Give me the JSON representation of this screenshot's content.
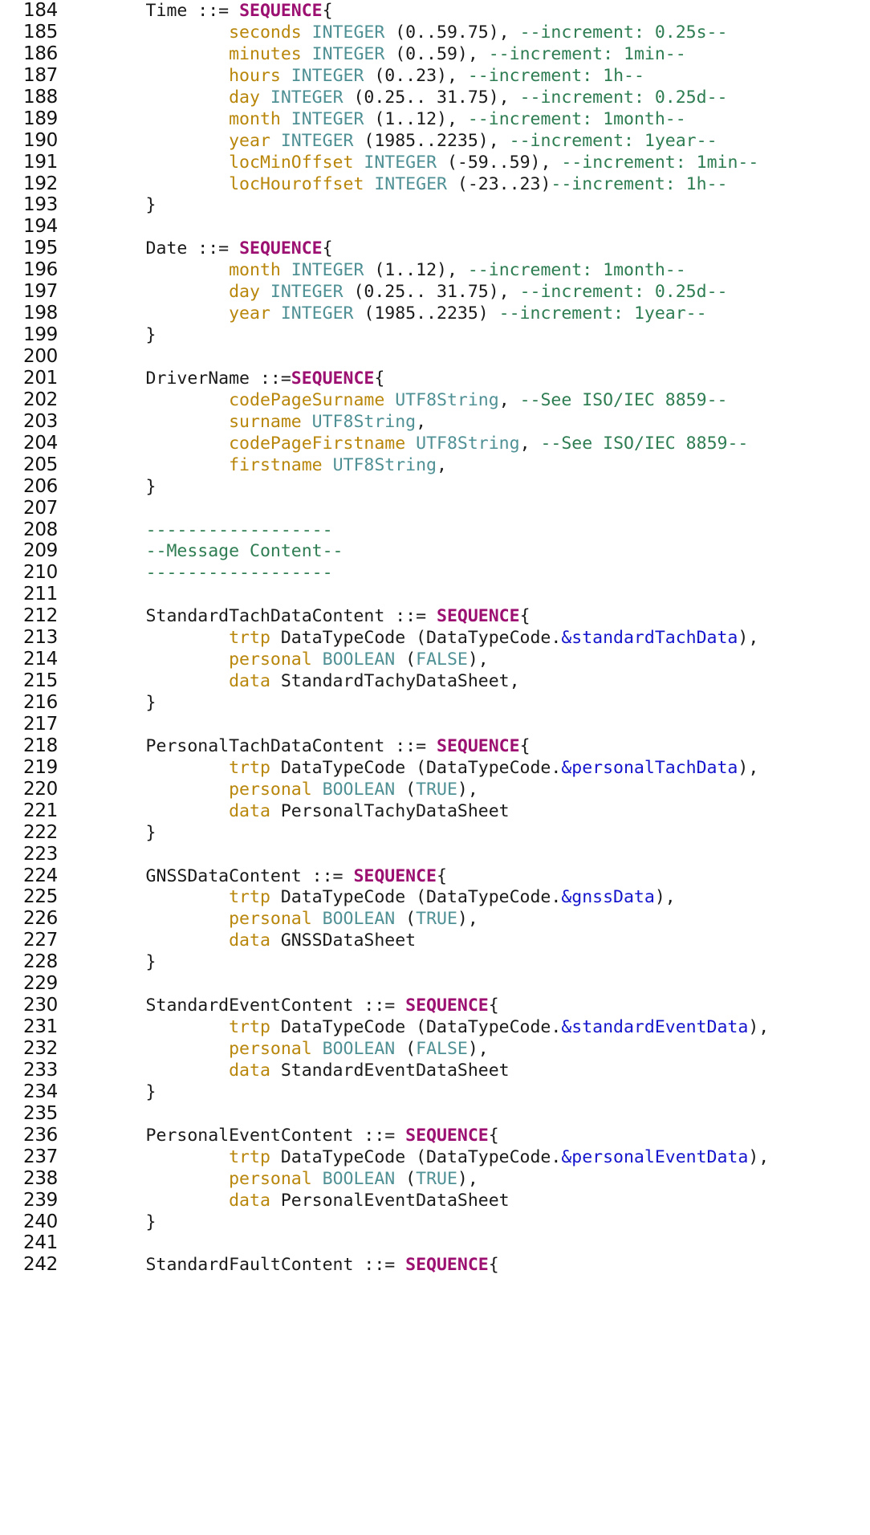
{
  "editor": {
    "language": "ASN.1",
    "first_line_number": 184,
    "last_line_number": 242,
    "colors": {
      "background": "#ffffff",
      "line_number": "#111111",
      "plain": "#1a1a1a",
      "field_name": "#B8860B",
      "type_name": "#4F9095",
      "comment": "#2E7D52",
      "keyword": "#9B1070",
      "reference": "#1414CC"
    }
  },
  "lines": [
    {
      "n": "184",
      "tokens": [
        {
          "t": "        Time ::= ",
          "c": "plain"
        },
        {
          "t": "SEQUENCE",
          "c": "kw"
        },
        {
          "t": "{",
          "c": "plain"
        }
      ]
    },
    {
      "n": "185",
      "tokens": [
        {
          "t": "                ",
          "c": "plain"
        },
        {
          "t": "seconds",
          "c": "field"
        },
        {
          "t": " ",
          "c": "plain"
        },
        {
          "t": "INTEGER",
          "c": "type"
        },
        {
          "t": " (0..59.75), ",
          "c": "plain"
        },
        {
          "t": "--increment: 0.25s--",
          "c": "comment"
        }
      ]
    },
    {
      "n": "186",
      "tokens": [
        {
          "t": "                ",
          "c": "plain"
        },
        {
          "t": "minutes",
          "c": "field"
        },
        {
          "t": " ",
          "c": "plain"
        },
        {
          "t": "INTEGER",
          "c": "type"
        },
        {
          "t": " (0..59), ",
          "c": "plain"
        },
        {
          "t": "--increment: 1min--",
          "c": "comment"
        }
      ]
    },
    {
      "n": "187",
      "tokens": [
        {
          "t": "                ",
          "c": "plain"
        },
        {
          "t": "hours",
          "c": "field"
        },
        {
          "t": " ",
          "c": "plain"
        },
        {
          "t": "INTEGER",
          "c": "type"
        },
        {
          "t": " (0..23), ",
          "c": "plain"
        },
        {
          "t": "--increment: 1h--",
          "c": "comment"
        }
      ]
    },
    {
      "n": "188",
      "tokens": [
        {
          "t": "                ",
          "c": "plain"
        },
        {
          "t": "day",
          "c": "field"
        },
        {
          "t": " ",
          "c": "plain"
        },
        {
          "t": "INTEGER",
          "c": "type"
        },
        {
          "t": " (0.25.. 31.75), ",
          "c": "plain"
        },
        {
          "t": "--increment: 0.25d--",
          "c": "comment"
        }
      ]
    },
    {
      "n": "189",
      "tokens": [
        {
          "t": "                ",
          "c": "plain"
        },
        {
          "t": "month",
          "c": "field"
        },
        {
          "t": " ",
          "c": "plain"
        },
        {
          "t": "INTEGER",
          "c": "type"
        },
        {
          "t": " (1..12), ",
          "c": "plain"
        },
        {
          "t": "--increment: 1month--",
          "c": "comment"
        }
      ]
    },
    {
      "n": "190",
      "tokens": [
        {
          "t": "                ",
          "c": "plain"
        },
        {
          "t": "year",
          "c": "field"
        },
        {
          "t": " ",
          "c": "plain"
        },
        {
          "t": "INTEGER",
          "c": "type"
        },
        {
          "t": " (1985..2235), ",
          "c": "plain"
        },
        {
          "t": "--increment: 1year--",
          "c": "comment"
        }
      ]
    },
    {
      "n": "191",
      "tokens": [
        {
          "t": "                ",
          "c": "plain"
        },
        {
          "t": "locMinOffset",
          "c": "field"
        },
        {
          "t": " ",
          "c": "plain"
        },
        {
          "t": "INTEGER",
          "c": "type"
        },
        {
          "t": " (-59..59), ",
          "c": "plain"
        },
        {
          "t": "--increment: 1min--",
          "c": "comment"
        }
      ]
    },
    {
      "n": "192",
      "tokens": [
        {
          "t": "                ",
          "c": "plain"
        },
        {
          "t": "locHouroffset",
          "c": "field"
        },
        {
          "t": " ",
          "c": "plain"
        },
        {
          "t": "INTEGER",
          "c": "type"
        },
        {
          "t": " (-23..23)",
          "c": "plain"
        },
        {
          "t": "--increment: 1h--",
          "c": "comment"
        }
      ]
    },
    {
      "n": "193",
      "tokens": [
        {
          "t": "        }",
          "c": "plain"
        }
      ]
    },
    {
      "n": "194",
      "tokens": []
    },
    {
      "n": "195",
      "tokens": [
        {
          "t": "        Date ::= ",
          "c": "plain"
        },
        {
          "t": "SEQUENCE",
          "c": "kw"
        },
        {
          "t": "{",
          "c": "plain"
        }
      ]
    },
    {
      "n": "196",
      "tokens": [
        {
          "t": "                ",
          "c": "plain"
        },
        {
          "t": "month",
          "c": "field"
        },
        {
          "t": " ",
          "c": "plain"
        },
        {
          "t": "INTEGER",
          "c": "type"
        },
        {
          "t": " (1..12), ",
          "c": "plain"
        },
        {
          "t": "--increment: 1month--",
          "c": "comment"
        }
      ]
    },
    {
      "n": "197",
      "tokens": [
        {
          "t": "                ",
          "c": "plain"
        },
        {
          "t": "day",
          "c": "field"
        },
        {
          "t": " ",
          "c": "plain"
        },
        {
          "t": "INTEGER",
          "c": "type"
        },
        {
          "t": " (0.25.. 31.75), ",
          "c": "plain"
        },
        {
          "t": "--increment: 0.25d--",
          "c": "comment"
        }
      ]
    },
    {
      "n": "198",
      "tokens": [
        {
          "t": "                ",
          "c": "plain"
        },
        {
          "t": "year",
          "c": "field"
        },
        {
          "t": " ",
          "c": "plain"
        },
        {
          "t": "INTEGER",
          "c": "type"
        },
        {
          "t": " (1985..2235) ",
          "c": "plain"
        },
        {
          "t": "--increment: 1year--",
          "c": "comment"
        }
      ]
    },
    {
      "n": "199",
      "tokens": [
        {
          "t": "        }",
          "c": "plain"
        }
      ]
    },
    {
      "n": "200",
      "tokens": []
    },
    {
      "n": "201",
      "tokens": [
        {
          "t": "        DriverName ::=",
          "c": "plain"
        },
        {
          "t": "SEQUENCE",
          "c": "kw"
        },
        {
          "t": "{",
          "c": "plain"
        }
      ]
    },
    {
      "n": "202",
      "tokens": [
        {
          "t": "                ",
          "c": "plain"
        },
        {
          "t": "codePageSurname",
          "c": "field"
        },
        {
          "t": " ",
          "c": "plain"
        },
        {
          "t": "UTF8String",
          "c": "type"
        },
        {
          "t": ", ",
          "c": "plain"
        },
        {
          "t": "--See ISO/IEC 8859--",
          "c": "comment"
        }
      ]
    },
    {
      "n": "203",
      "tokens": [
        {
          "t": "                ",
          "c": "plain"
        },
        {
          "t": "surname",
          "c": "field"
        },
        {
          "t": " ",
          "c": "plain"
        },
        {
          "t": "UTF8String",
          "c": "type"
        },
        {
          "t": ",",
          "c": "plain"
        }
      ]
    },
    {
      "n": "204",
      "tokens": [
        {
          "t": "                ",
          "c": "plain"
        },
        {
          "t": "codePageFirstname",
          "c": "field"
        },
        {
          "t": " ",
          "c": "plain"
        },
        {
          "t": "UTF8String",
          "c": "type"
        },
        {
          "t": ", ",
          "c": "plain"
        },
        {
          "t": "--See ISO/IEC 8859--",
          "c": "comment"
        }
      ]
    },
    {
      "n": "205",
      "tokens": [
        {
          "t": "                ",
          "c": "plain"
        },
        {
          "t": "firstname",
          "c": "field"
        },
        {
          "t": " ",
          "c": "plain"
        },
        {
          "t": "UTF8String",
          "c": "type"
        },
        {
          "t": ",",
          "c": "plain"
        }
      ]
    },
    {
      "n": "206",
      "tokens": [
        {
          "t": "        }",
          "c": "plain"
        }
      ]
    },
    {
      "n": "207",
      "tokens": []
    },
    {
      "n": "208",
      "tokens": [
        {
          "t": "        ",
          "c": "plain"
        },
        {
          "t": "------------------",
          "c": "comment"
        }
      ]
    },
    {
      "n": "209",
      "tokens": [
        {
          "t": "        ",
          "c": "plain"
        },
        {
          "t": "--Message Content--",
          "c": "comment"
        }
      ]
    },
    {
      "n": "210",
      "tokens": [
        {
          "t": "        ",
          "c": "plain"
        },
        {
          "t": "------------------",
          "c": "comment"
        }
      ]
    },
    {
      "n": "211",
      "tokens": []
    },
    {
      "n": "212",
      "tokens": [
        {
          "t": "        StandardTachDataContent ::= ",
          "c": "plain"
        },
        {
          "t": "SEQUENCE",
          "c": "kw"
        },
        {
          "t": "{",
          "c": "plain"
        }
      ]
    },
    {
      "n": "213",
      "tokens": [
        {
          "t": "                ",
          "c": "plain"
        },
        {
          "t": "trtp",
          "c": "field"
        },
        {
          "t": " DataTypeCode (DataTypeCode.",
          "c": "plain"
        },
        {
          "t": "&standardTachData",
          "c": "ref"
        },
        {
          "t": "),",
          "c": "plain"
        }
      ]
    },
    {
      "n": "214",
      "tokens": [
        {
          "t": "                ",
          "c": "plain"
        },
        {
          "t": "personal",
          "c": "field"
        },
        {
          "t": " ",
          "c": "plain"
        },
        {
          "t": "BOOLEAN",
          "c": "type"
        },
        {
          "t": " (",
          "c": "plain"
        },
        {
          "t": "FALSE",
          "c": "type"
        },
        {
          "t": "),",
          "c": "plain"
        }
      ]
    },
    {
      "n": "215",
      "tokens": [
        {
          "t": "                ",
          "c": "plain"
        },
        {
          "t": "data",
          "c": "field"
        },
        {
          "t": " StandardTachyDataSheet,",
          "c": "plain"
        }
      ]
    },
    {
      "n": "216",
      "tokens": [
        {
          "t": "        }",
          "c": "plain"
        }
      ]
    },
    {
      "n": "217",
      "tokens": []
    },
    {
      "n": "218",
      "tokens": [
        {
          "t": "        PersonalTachDataContent ::= ",
          "c": "plain"
        },
        {
          "t": "SEQUENCE",
          "c": "kw"
        },
        {
          "t": "{",
          "c": "plain"
        }
      ]
    },
    {
      "n": "219",
      "tokens": [
        {
          "t": "                ",
          "c": "plain"
        },
        {
          "t": "trtp",
          "c": "field"
        },
        {
          "t": " DataTypeCode (DataTypeCode.",
          "c": "plain"
        },
        {
          "t": "&personalTachData",
          "c": "ref"
        },
        {
          "t": "),",
          "c": "plain"
        }
      ]
    },
    {
      "n": "220",
      "tokens": [
        {
          "t": "                ",
          "c": "plain"
        },
        {
          "t": "personal",
          "c": "field"
        },
        {
          "t": " ",
          "c": "plain"
        },
        {
          "t": "BOOLEAN",
          "c": "type"
        },
        {
          "t": " (",
          "c": "plain"
        },
        {
          "t": "TRUE",
          "c": "type"
        },
        {
          "t": "),",
          "c": "plain"
        }
      ]
    },
    {
      "n": "221",
      "tokens": [
        {
          "t": "                ",
          "c": "plain"
        },
        {
          "t": "data",
          "c": "field"
        },
        {
          "t": " PersonalTachyDataSheet",
          "c": "plain"
        }
      ]
    },
    {
      "n": "222",
      "tokens": [
        {
          "t": "        }",
          "c": "plain"
        }
      ]
    },
    {
      "n": "223",
      "tokens": []
    },
    {
      "n": "224",
      "tokens": [
        {
          "t": "        GNSSDataContent ::= ",
          "c": "plain"
        },
        {
          "t": "SEQUENCE",
          "c": "kw"
        },
        {
          "t": "{",
          "c": "plain"
        }
      ]
    },
    {
      "n": "225",
      "tokens": [
        {
          "t": "                ",
          "c": "plain"
        },
        {
          "t": "trtp",
          "c": "field"
        },
        {
          "t": " DataTypeCode (DataTypeCode.",
          "c": "plain"
        },
        {
          "t": "&gnssData",
          "c": "ref"
        },
        {
          "t": "),",
          "c": "plain"
        }
      ]
    },
    {
      "n": "226",
      "tokens": [
        {
          "t": "                ",
          "c": "plain"
        },
        {
          "t": "personal",
          "c": "field"
        },
        {
          "t": " ",
          "c": "plain"
        },
        {
          "t": "BOOLEAN",
          "c": "type"
        },
        {
          "t": " (",
          "c": "plain"
        },
        {
          "t": "TRUE",
          "c": "type"
        },
        {
          "t": "),",
          "c": "plain"
        }
      ]
    },
    {
      "n": "227",
      "tokens": [
        {
          "t": "                ",
          "c": "plain"
        },
        {
          "t": "data",
          "c": "field"
        },
        {
          "t": " GNSSDataSheet",
          "c": "plain"
        }
      ]
    },
    {
      "n": "228",
      "tokens": [
        {
          "t": "        }",
          "c": "plain"
        }
      ]
    },
    {
      "n": "229",
      "tokens": []
    },
    {
      "n": "230",
      "tokens": [
        {
          "t": "        StandardEventContent ::= ",
          "c": "plain"
        },
        {
          "t": "SEQUENCE",
          "c": "kw"
        },
        {
          "t": "{",
          "c": "plain"
        }
      ]
    },
    {
      "n": "231",
      "tokens": [
        {
          "t": "                ",
          "c": "plain"
        },
        {
          "t": "trtp",
          "c": "field"
        },
        {
          "t": " DataTypeCode (DataTypeCode.",
          "c": "plain"
        },
        {
          "t": "&standardEventData",
          "c": "ref"
        },
        {
          "t": "),",
          "c": "plain"
        }
      ]
    },
    {
      "n": "232",
      "tokens": [
        {
          "t": "                ",
          "c": "plain"
        },
        {
          "t": "personal",
          "c": "field"
        },
        {
          "t": " ",
          "c": "plain"
        },
        {
          "t": "BOOLEAN",
          "c": "type"
        },
        {
          "t": " (",
          "c": "plain"
        },
        {
          "t": "FALSE",
          "c": "type"
        },
        {
          "t": "),",
          "c": "plain"
        }
      ]
    },
    {
      "n": "233",
      "tokens": [
        {
          "t": "                ",
          "c": "plain"
        },
        {
          "t": "data",
          "c": "field"
        },
        {
          "t": " StandardEventDataSheet",
          "c": "plain"
        }
      ]
    },
    {
      "n": "234",
      "tokens": [
        {
          "t": "        }",
          "c": "plain"
        }
      ]
    },
    {
      "n": "235",
      "tokens": []
    },
    {
      "n": "236",
      "tokens": [
        {
          "t": "        PersonalEventContent ::= ",
          "c": "plain"
        },
        {
          "t": "SEQUENCE",
          "c": "kw"
        },
        {
          "t": "{",
          "c": "plain"
        }
      ]
    },
    {
      "n": "237",
      "tokens": [
        {
          "t": "                ",
          "c": "plain"
        },
        {
          "t": "trtp",
          "c": "field"
        },
        {
          "t": " DataTypeCode (DataTypeCode.",
          "c": "plain"
        },
        {
          "t": "&personalEventData",
          "c": "ref"
        },
        {
          "t": "),",
          "c": "plain"
        }
      ]
    },
    {
      "n": "238",
      "tokens": [
        {
          "t": "                ",
          "c": "plain"
        },
        {
          "t": "personal",
          "c": "field"
        },
        {
          "t": " ",
          "c": "plain"
        },
        {
          "t": "BOOLEAN",
          "c": "type"
        },
        {
          "t": " (",
          "c": "plain"
        },
        {
          "t": "TRUE",
          "c": "type"
        },
        {
          "t": "),",
          "c": "plain"
        }
      ]
    },
    {
      "n": "239",
      "tokens": [
        {
          "t": "                ",
          "c": "plain"
        },
        {
          "t": "data",
          "c": "field"
        },
        {
          "t": " PersonalEventDataSheet",
          "c": "plain"
        }
      ]
    },
    {
      "n": "240",
      "tokens": [
        {
          "t": "        }",
          "c": "plain"
        }
      ]
    },
    {
      "n": "241",
      "tokens": []
    },
    {
      "n": "242",
      "tokens": [
        {
          "t": "        StandardFaultContent ::= ",
          "c": "plain"
        },
        {
          "t": "SEQUENCE",
          "c": "kw"
        },
        {
          "t": "{",
          "c": "plain"
        }
      ]
    }
  ]
}
